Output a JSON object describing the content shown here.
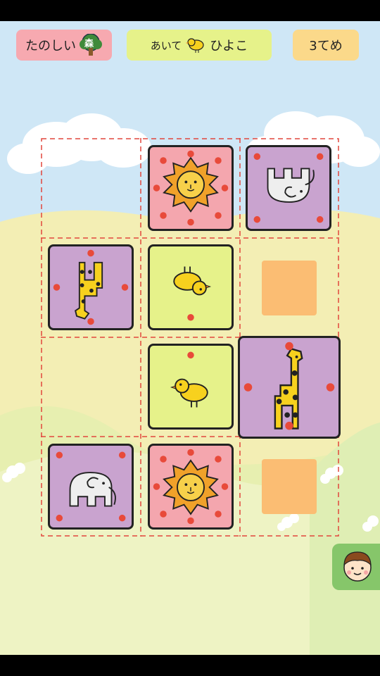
{
  "header": {
    "forest_label": "たのしい",
    "forest_icon_text": "森",
    "opponent_prefix": "あいて",
    "opponent_name": "ひよこ",
    "turn_label": "3てめ"
  },
  "board": {
    "rows": 4,
    "cols": 3,
    "pieces": [
      {
        "row": 0,
        "col": 1,
        "animal": "lion",
        "color": "pink"
      },
      {
        "row": 0,
        "col": 2,
        "animal": "elephant",
        "color": "purple",
        "rotated": true
      },
      {
        "row": 1,
        "col": 0,
        "animal": "giraffe",
        "color": "purple",
        "rotated": true
      },
      {
        "row": 1,
        "col": 1,
        "animal": "chick",
        "color": "green",
        "rotated": true
      },
      {
        "row": 2,
        "col": 1,
        "animal": "chick",
        "color": "green"
      },
      {
        "row": 2,
        "col": 2,
        "animal": "giraffe",
        "color": "purple",
        "selected": true
      },
      {
        "row": 3,
        "col": 0,
        "animal": "elephant",
        "color": "purple"
      },
      {
        "row": 3,
        "col": 1,
        "animal": "lion",
        "color": "pink"
      }
    ],
    "move_hints": [
      {
        "row": 1,
        "col": 2
      },
      {
        "row": 3,
        "col": 2
      }
    ]
  },
  "colors": {
    "pink_tile": "#f4a6ae",
    "purple_tile": "#c9a3cf",
    "green_tile": "#e6f28a",
    "hint": "#fbbd73",
    "dot": "#e84a3a",
    "grid_line": "#e2463d"
  }
}
